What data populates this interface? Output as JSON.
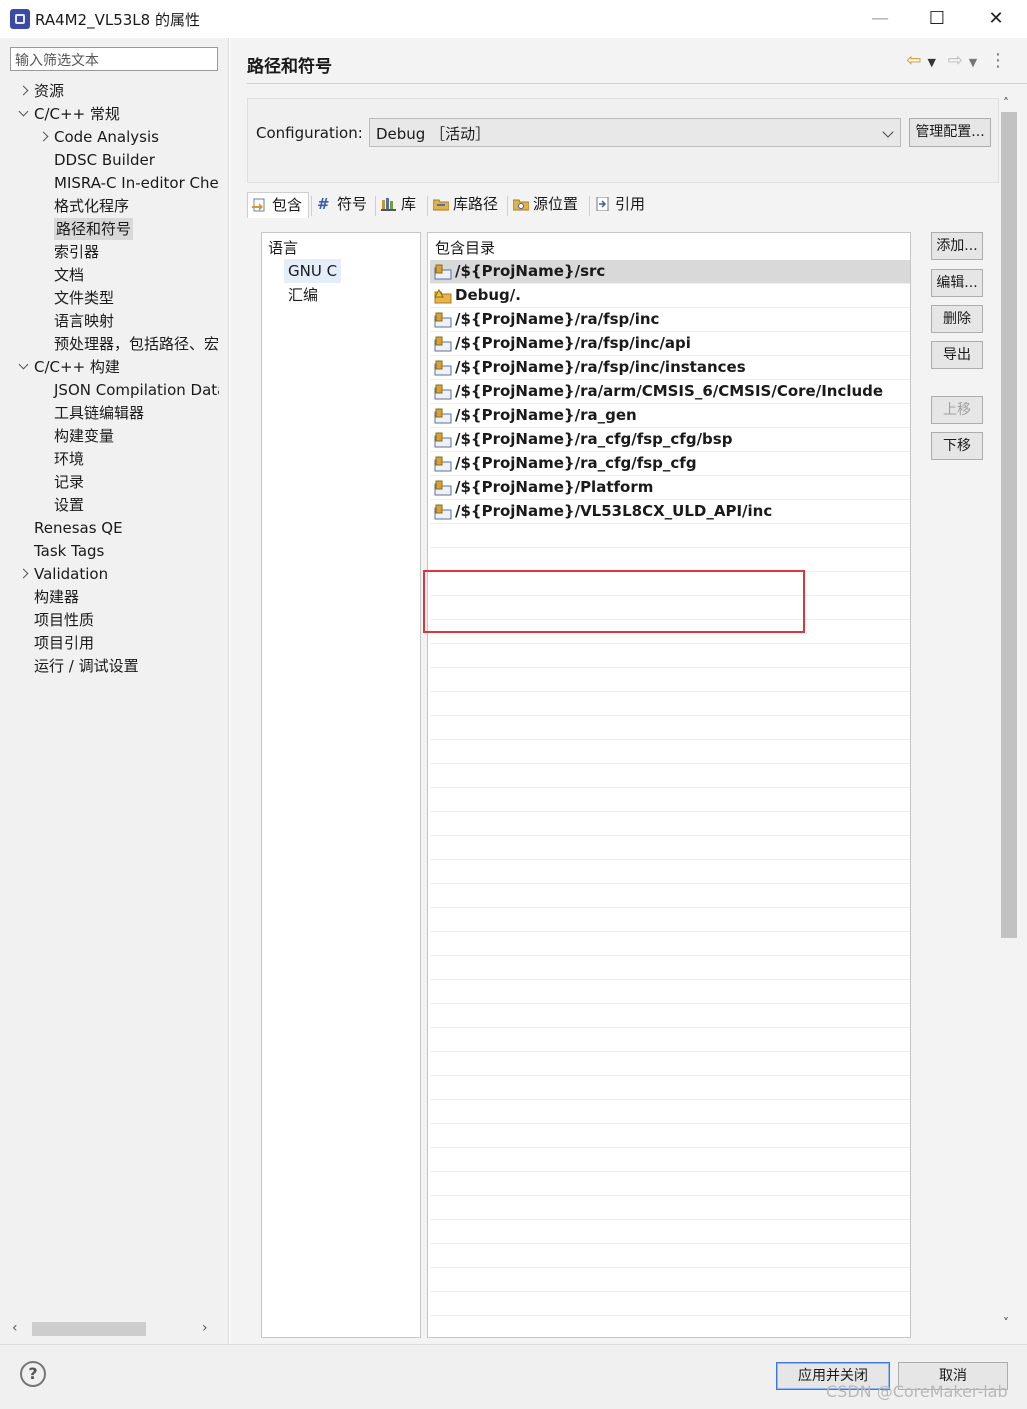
{
  "window": {
    "title": "RA4M2_VL53L8 的属性",
    "controls": {
      "minimize": "—",
      "maximize": "☐",
      "close": "✕"
    }
  },
  "sidebar": {
    "filter_placeholder": "输入筛选文本",
    "items": [
      {
        "label": "资源",
        "level": 1,
        "twisty": "collapsed"
      },
      {
        "label": "C/C++ 常规",
        "level": 1,
        "twisty": "expanded"
      },
      {
        "label": "Code Analysis",
        "level": 2,
        "twisty": "collapsed"
      },
      {
        "label": "DDSC Builder",
        "level": 2
      },
      {
        "label": "MISRA-C In-editor Che",
        "level": 2
      },
      {
        "label": "格式化程序",
        "level": 2
      },
      {
        "label": "路径和符号",
        "level": 2,
        "selected": true
      },
      {
        "label": "索引器",
        "level": 2
      },
      {
        "label": "文档",
        "level": 2
      },
      {
        "label": "文件类型",
        "level": 2
      },
      {
        "label": "语言映射",
        "level": 2
      },
      {
        "label": "预处理器，包括路径、宏",
        "level": 2
      },
      {
        "label": "C/C++ 构建",
        "level": 1,
        "twisty": "expanded"
      },
      {
        "label": "JSON Compilation Data",
        "level": 2
      },
      {
        "label": "工具链编辑器",
        "level": 2
      },
      {
        "label": "构建变量",
        "level": 2
      },
      {
        "label": "环境",
        "level": 2
      },
      {
        "label": "记录",
        "level": 2
      },
      {
        "label": "设置",
        "level": 2
      },
      {
        "label": "Renesas QE",
        "level": 1
      },
      {
        "label": "Task Tags",
        "level": 1
      },
      {
        "label": "Validation",
        "level": 1,
        "twisty": "collapsed"
      },
      {
        "label": "构建器",
        "level": 1
      },
      {
        "label": "项目性质",
        "level": 1
      },
      {
        "label": "项目引用",
        "level": 1
      },
      {
        "label": "运行 / 调试设置",
        "level": 1
      }
    ]
  },
  "page": {
    "title": "路径和符号",
    "config_label": "Configuration:",
    "config_value": "Debug ［活动］",
    "manage_button": "管理配置...",
    "tabs": [
      "包含",
      "符号",
      "库",
      "库路径",
      "源位置",
      "引用"
    ],
    "active_tab": "包含",
    "languages_header": "语言",
    "languages": [
      "GNU C",
      "汇编"
    ],
    "include_header": "包含目录",
    "includes": [
      {
        "path": "/${ProjName}/src",
        "selected": true,
        "icon": "workspace-folder-icon"
      },
      {
        "path": "Debug/.",
        "icon": "warning-folder-icon"
      },
      {
        "path": "/${ProjName}/ra/fsp/inc",
        "icon": "workspace-folder-icon"
      },
      {
        "path": "/${ProjName}/ra/fsp/inc/api",
        "icon": "workspace-folder-icon"
      },
      {
        "path": "/${ProjName}/ra/fsp/inc/instances",
        "icon": "workspace-folder-icon"
      },
      {
        "path": "/${ProjName}/ra/arm/CMSIS_6/CMSIS/Core/Include",
        "icon": "workspace-folder-icon"
      },
      {
        "path": "/${ProjName}/ra_gen",
        "icon": "workspace-folder-icon"
      },
      {
        "path": "/${ProjName}/ra_cfg/fsp_cfg/bsp",
        "icon": "workspace-folder-icon"
      },
      {
        "path": "/${ProjName}/ra_cfg/fsp_cfg",
        "icon": "workspace-folder-icon"
      },
      {
        "path": "/${ProjName}/Platform",
        "icon": "workspace-folder-icon"
      },
      {
        "path": "/${ProjName}/VL53L8CX_ULD_API/inc",
        "icon": "workspace-folder-icon"
      }
    ],
    "side_buttons": [
      {
        "label": "添加...",
        "enabled": true
      },
      {
        "label": "编辑...",
        "enabled": true
      },
      {
        "label": "删除",
        "enabled": true
      },
      {
        "label": "导出",
        "enabled": true
      },
      {
        "label": "上移",
        "enabled": false
      },
      {
        "label": "下移",
        "enabled": true
      }
    ]
  },
  "footer": {
    "help": "?",
    "apply_close": "应用并关闭",
    "cancel": "取消",
    "watermark": "CSDN @CoreMaker-lab"
  },
  "colors": {
    "highlight_box": "#d9363e",
    "selected_row": "#d9d9d9",
    "accent": "#3b79d4"
  }
}
